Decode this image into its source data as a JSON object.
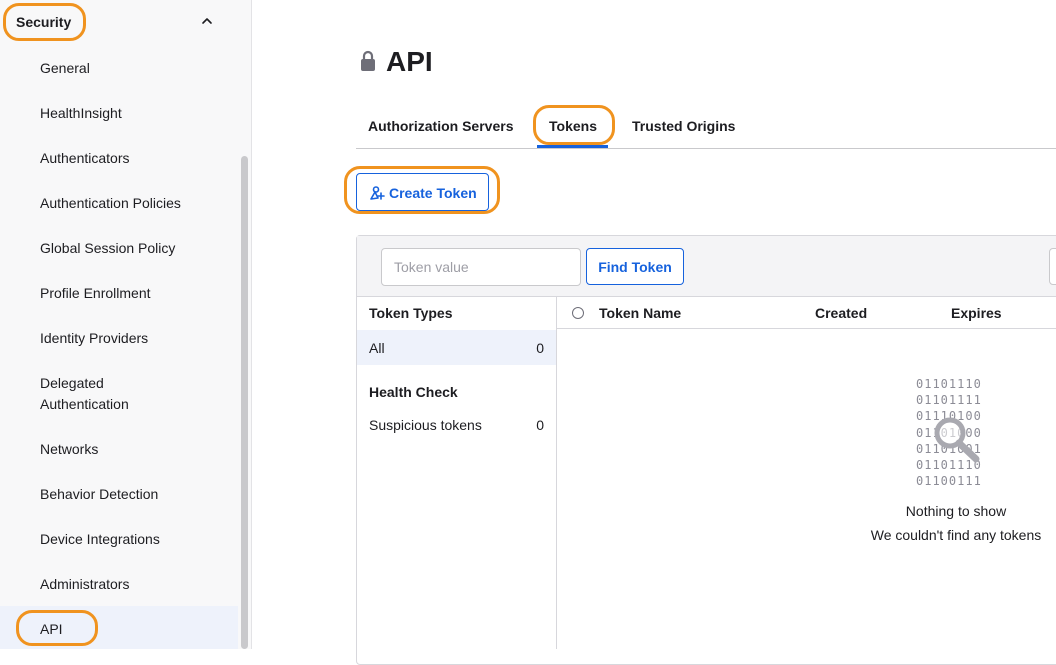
{
  "sidebar": {
    "section_title": "Security",
    "items": [
      {
        "label": "General"
      },
      {
        "label": "HealthInsight"
      },
      {
        "label": "Authenticators"
      },
      {
        "label": "Authentication Policies"
      },
      {
        "label": "Global Session Policy"
      },
      {
        "label": "Profile Enrollment"
      },
      {
        "label": "Identity Providers"
      },
      {
        "label": "Delegated",
        "label2": "Authentication"
      },
      {
        "label": "Networks"
      },
      {
        "label": "Behavior Detection"
      },
      {
        "label": "Device Integrations"
      },
      {
        "label": "Administrators"
      },
      {
        "label": "API"
      }
    ],
    "active_item": "API"
  },
  "page": {
    "title": "API",
    "tabs": [
      {
        "label": "Authorization Servers"
      },
      {
        "label": "Tokens"
      },
      {
        "label": "Trusted Origins"
      }
    ],
    "active_tab": "Tokens",
    "create_button": "Create Token"
  },
  "search": {
    "placeholder": "Token value",
    "value": "",
    "find_button": "Find Token"
  },
  "filters": {
    "types_heading": "Token Types",
    "all_label": "All",
    "all_count": "0",
    "health_heading": "Health Check",
    "suspicious_label": "Suspicious tokens",
    "suspicious_count": "0"
  },
  "table": {
    "columns": [
      "Token Name",
      "Created",
      "Expires"
    ]
  },
  "empty_state": {
    "binary": "01101110\n01101111\n01110100\n01101000\n01101001\n01101110\n01100111",
    "title": "Nothing to show",
    "subtitle": "We couldn't find any tokens"
  },
  "colors": {
    "accent": "#1662dd",
    "highlight_ring": "#f0931f",
    "selected_row": "#eef2fb"
  }
}
